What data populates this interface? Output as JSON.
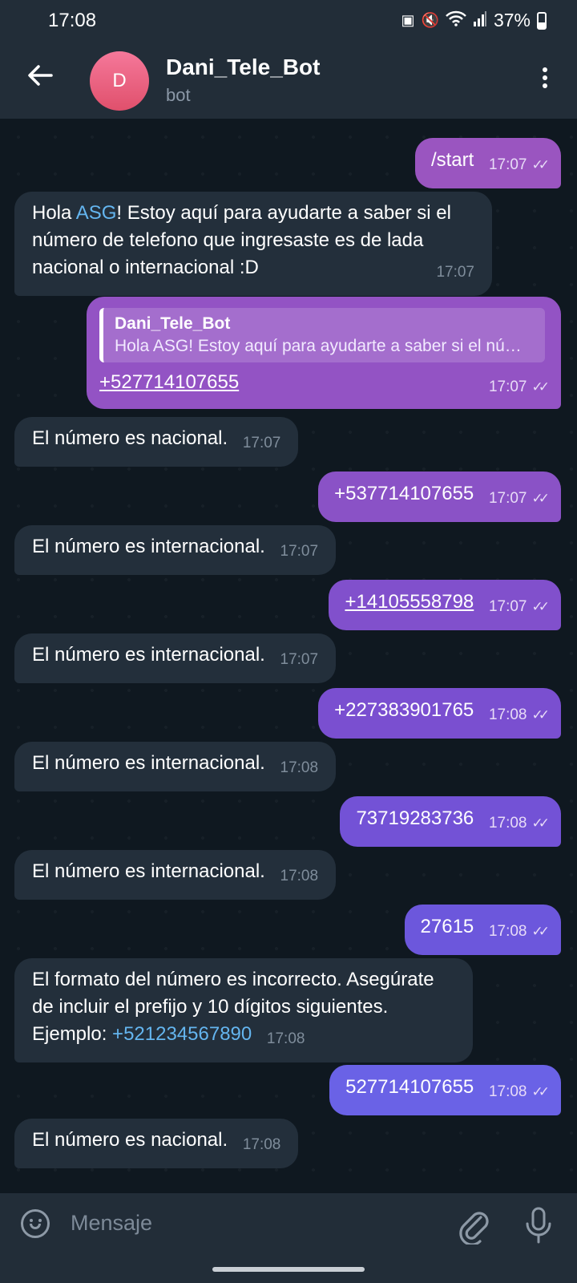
{
  "status_bar": {
    "time": "17:08",
    "battery": "37%"
  },
  "header": {
    "avatar_letter": "D",
    "title": "Dani_Tele_Bot",
    "subtitle": "bot"
  },
  "messages": [
    {
      "text": "/start",
      "time": "17:07"
    },
    {
      "text_before": "Hola ",
      "link": "ASG",
      "text_after": "! Estoy aquí para ayudarte a saber si el número de telefono que ingresaste es de lada nacional o internacional :D",
      "time": "17:07"
    },
    {
      "reply_name": "Dani_Tele_Bot",
      "reply_text": "Hola ASG! Estoy aquí para ayudarte a saber si el número de telefono que ingresaste es de lada nacional o internacional :D",
      "text": "+527714107655",
      "time": "17:07"
    },
    {
      "text": "El número es nacional.",
      "time": "17:07"
    },
    {
      "text": "+537714107655",
      "time": "17:07"
    },
    {
      "text": "El número es internacional.",
      "time": "17:07"
    },
    {
      "text": "+14105558798",
      "time": "17:07"
    },
    {
      "text": "El número es internacional.",
      "time": "17:07"
    },
    {
      "text": "+227383901765",
      "time": "17:08"
    },
    {
      "text": "El número es internacional.",
      "time": "17:08"
    },
    {
      "text": "73719283736",
      "time": "17:08"
    },
    {
      "text": "El número es internacional.",
      "time": "17:08"
    },
    {
      "text": "27615",
      "time": "17:08"
    },
    {
      "text": "El formato del número es incorrecto. Asegúrate de incluir el prefijo y 10 dígitos siguientes. Ejemplo: ",
      "link": "+521234567890",
      "time": "17:08"
    },
    {
      "text": "527714107655",
      "time": "17:08"
    },
    {
      "text": "El número es nacional.",
      "time": "17:08"
    }
  ],
  "input": {
    "placeholder": "Mensaje"
  },
  "colors": {
    "outgoing_top": "#9a55c0",
    "outgoing_bottom": "#6a62e6",
    "incoming": "#232f3b",
    "link": "#64b5ef"
  }
}
